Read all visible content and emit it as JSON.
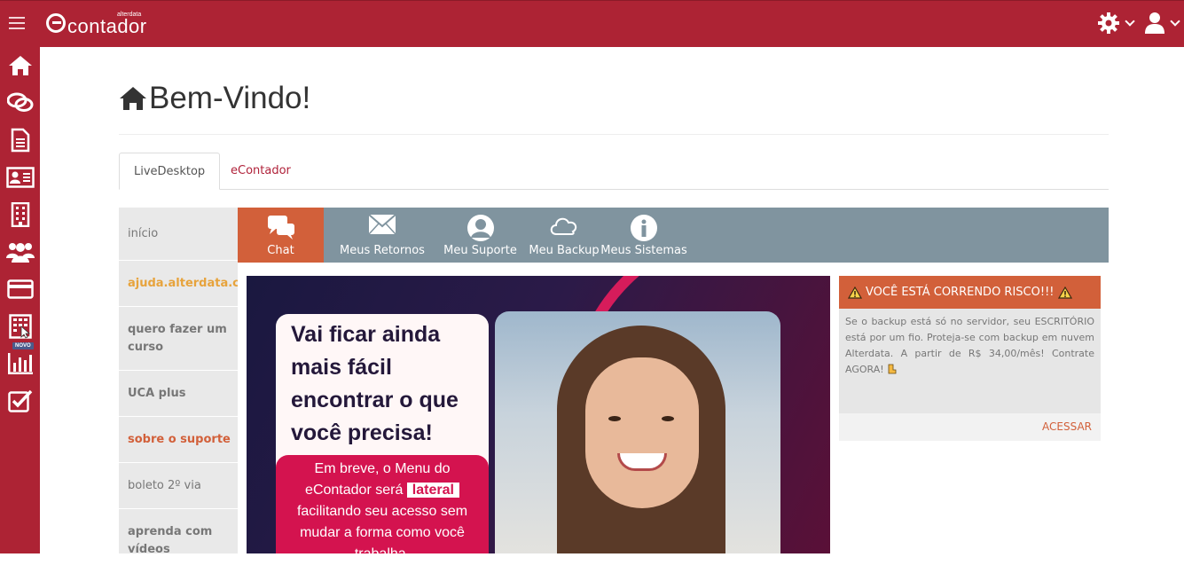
{
  "header": {
    "logo_text": "contador",
    "logo_small": "alterdata",
    "menu_icon": "hamburger-icon",
    "settings_icon": "gear-icon",
    "user_icon": "user-icon",
    "bar_color": "#ad2334"
  },
  "sidebar": {
    "items": [
      {
        "icon": "home-icon"
      },
      {
        "icon": "chat-icon"
      },
      {
        "icon": "document-icon"
      },
      {
        "icon": "contact-card-icon"
      },
      {
        "icon": "building-icon"
      },
      {
        "icon": "users-icon"
      },
      {
        "icon": "credit-card-icon"
      },
      {
        "icon": "calculator-icon"
      },
      {
        "icon": "bar-chart-icon"
      },
      {
        "icon": "checklist-icon"
      }
    ],
    "novo_badge": "NOVO"
  },
  "page": {
    "title": "Bem-Vindo!",
    "tabs": [
      {
        "label": "LiveDesktop",
        "active": true
      },
      {
        "label": "eContador",
        "active": false
      }
    ]
  },
  "menu": {
    "items": [
      {
        "label": "início",
        "color": "#777777",
        "bold": false
      },
      {
        "label": "ajuda.alterdata.com.br",
        "color": "#e7a33c",
        "bold": true
      },
      {
        "label": "quero fazer um curso",
        "color": "#777777",
        "bold": true
      },
      {
        "label": "UCA plus",
        "color": "#777777",
        "bold": true
      },
      {
        "label": "sobre o suporte",
        "color": "#d2603a",
        "bold": true
      },
      {
        "label": "boleto 2º via",
        "color": "#777777",
        "bold": false
      },
      {
        "label": "aprenda com vídeos",
        "color": "#777777",
        "bold": true
      }
    ]
  },
  "services": [
    {
      "label": "Chat",
      "icon": "chat-bubbles-icon",
      "active": true
    },
    {
      "label": "Meus Retornos",
      "icon": "envelope-icon",
      "active": false
    },
    {
      "label": "Meu Suporte",
      "icon": "support-person-icon",
      "active": false
    },
    {
      "label": "Meu Backup",
      "icon": "cloud-icon",
      "active": false
    },
    {
      "label": "Meus Sistemas",
      "icon": "info-icon",
      "active": false
    }
  ],
  "banner": {
    "headline": "Vai ficar ainda mais fácil encontrar o que você precisa!",
    "sub_pre": "Em breve, o Menu do eContador será",
    "sub_highlight": "lateral",
    "sub_post": "facilitando seu acesso sem mudar a forma como você trabalha."
  },
  "risk": {
    "title": "VOCÊ ESTÁ CORRENDO RISCO!!!",
    "body": "Se o backup está só no servidor, seu ESCRITÓRIO está por um fio. Proteja-se com backup em nuvem Alterdata. A partir de R$ 34,00/mês! Contrate AGORA!",
    "action": "ACESSAR",
    "icon": "warning-icon"
  }
}
